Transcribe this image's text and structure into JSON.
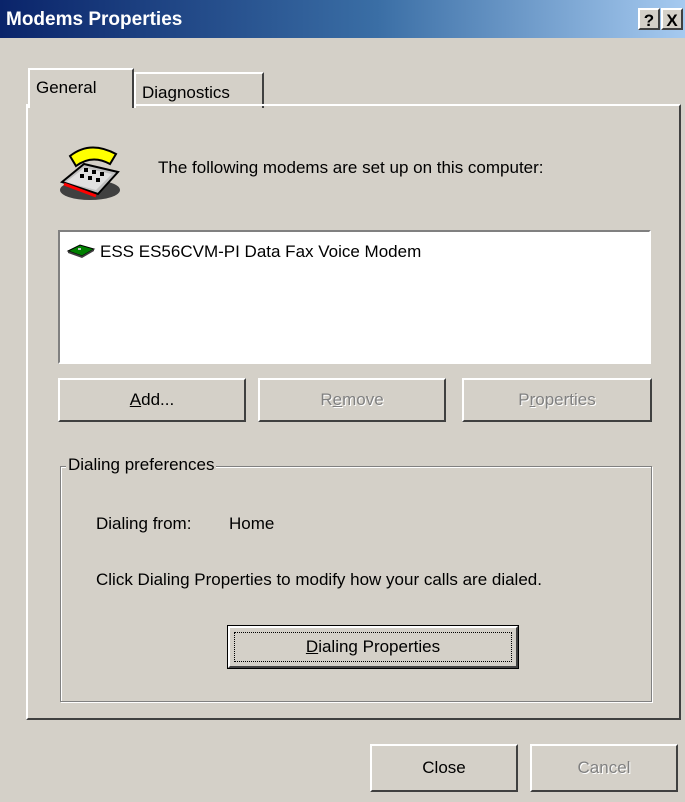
{
  "window": {
    "title": "Modems Properties",
    "help_label": "?",
    "close_label": "X"
  },
  "tabs": [
    {
      "label": "General",
      "active": true
    },
    {
      "label": "Diagnostics",
      "active": false
    }
  ],
  "general": {
    "heading": "The following modems are set up on this computer:",
    "modems": [
      "ESS ES56CVM-PI Data Fax Voice Modem"
    ],
    "buttons": {
      "add": {
        "pre": "",
        "key": "A",
        "post": "dd..."
      },
      "remove": {
        "pre": "R",
        "key": "e",
        "post": "move"
      },
      "properties": {
        "pre": "P",
        "key": "r",
        "post": "operties"
      }
    },
    "dialing_preferences": {
      "label": "Dialing preferences",
      "from_label": "Dialing from:",
      "from_value": "Home",
      "info": "Click Dialing Properties to modify how your calls are dialed.",
      "button": {
        "pre": "",
        "key": "D",
        "post": "ialing Properties"
      }
    }
  },
  "footer": {
    "close": "Close",
    "cancel": "Cancel"
  },
  "icons": {
    "phone": "telephone-modem-icon",
    "modem": "modem-device-icon"
  }
}
